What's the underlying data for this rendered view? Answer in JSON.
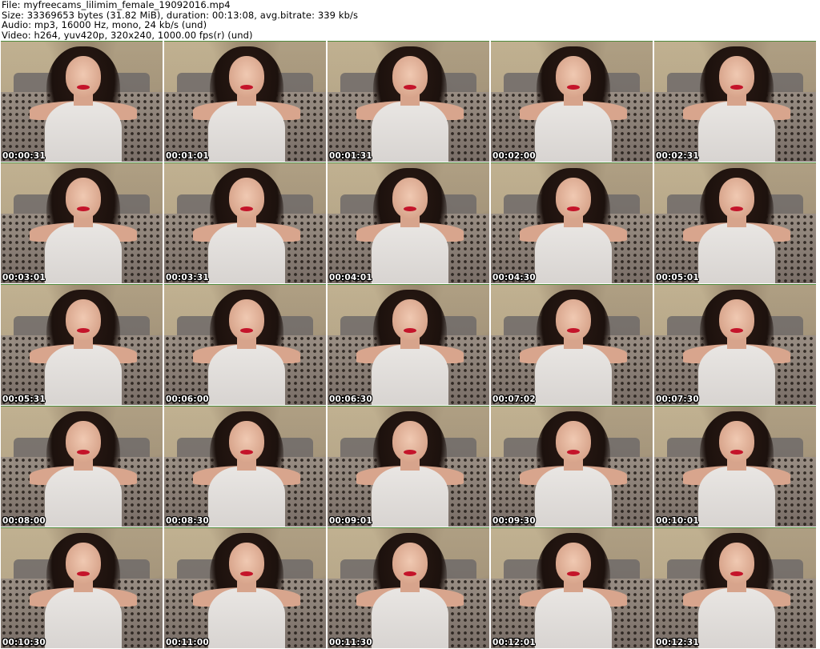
{
  "header": {
    "file": "File: myfreecams_lilimim_female_19092016.mp4",
    "size": "Size: 33369653 bytes (31.82 MiB), duration: 00:13:08, avg.bitrate: 339 kb/s",
    "audio": "Audio: mp3, 16000 Hz, mono, 24 kb/s (und)",
    "video": "Video: h264, yuv420p, 320x240, 1000.00 fps(r) (und)"
  },
  "thumbnails": [
    {
      "timestamp": "00:00:31"
    },
    {
      "timestamp": "00:01:01"
    },
    {
      "timestamp": "00:01:31"
    },
    {
      "timestamp": "00:02:00"
    },
    {
      "timestamp": "00:02:31"
    },
    {
      "timestamp": "00:03:01"
    },
    {
      "timestamp": "00:03:31"
    },
    {
      "timestamp": "00:04:01"
    },
    {
      "timestamp": "00:04:30"
    },
    {
      "timestamp": "00:05:01"
    },
    {
      "timestamp": "00:05:31"
    },
    {
      "timestamp": "00:06:00"
    },
    {
      "timestamp": "00:06:30"
    },
    {
      "timestamp": "00:07:02"
    },
    {
      "timestamp": "00:07:30"
    },
    {
      "timestamp": "00:08:00"
    },
    {
      "timestamp": "00:08:30"
    },
    {
      "timestamp": "00:09:01"
    },
    {
      "timestamp": "00:09:30"
    },
    {
      "timestamp": "00:10:01"
    },
    {
      "timestamp": "00:10:30"
    },
    {
      "timestamp": "00:11:00"
    },
    {
      "timestamp": "00:11:30"
    },
    {
      "timestamp": "00:12:01"
    },
    {
      "timestamp": "00:12:31"
    }
  ],
  "colors": {
    "background": "#ffffff",
    "frame_border": "#4f8a3c",
    "timestamp_text": "#ffffff",
    "timestamp_outline": "#000000"
  }
}
